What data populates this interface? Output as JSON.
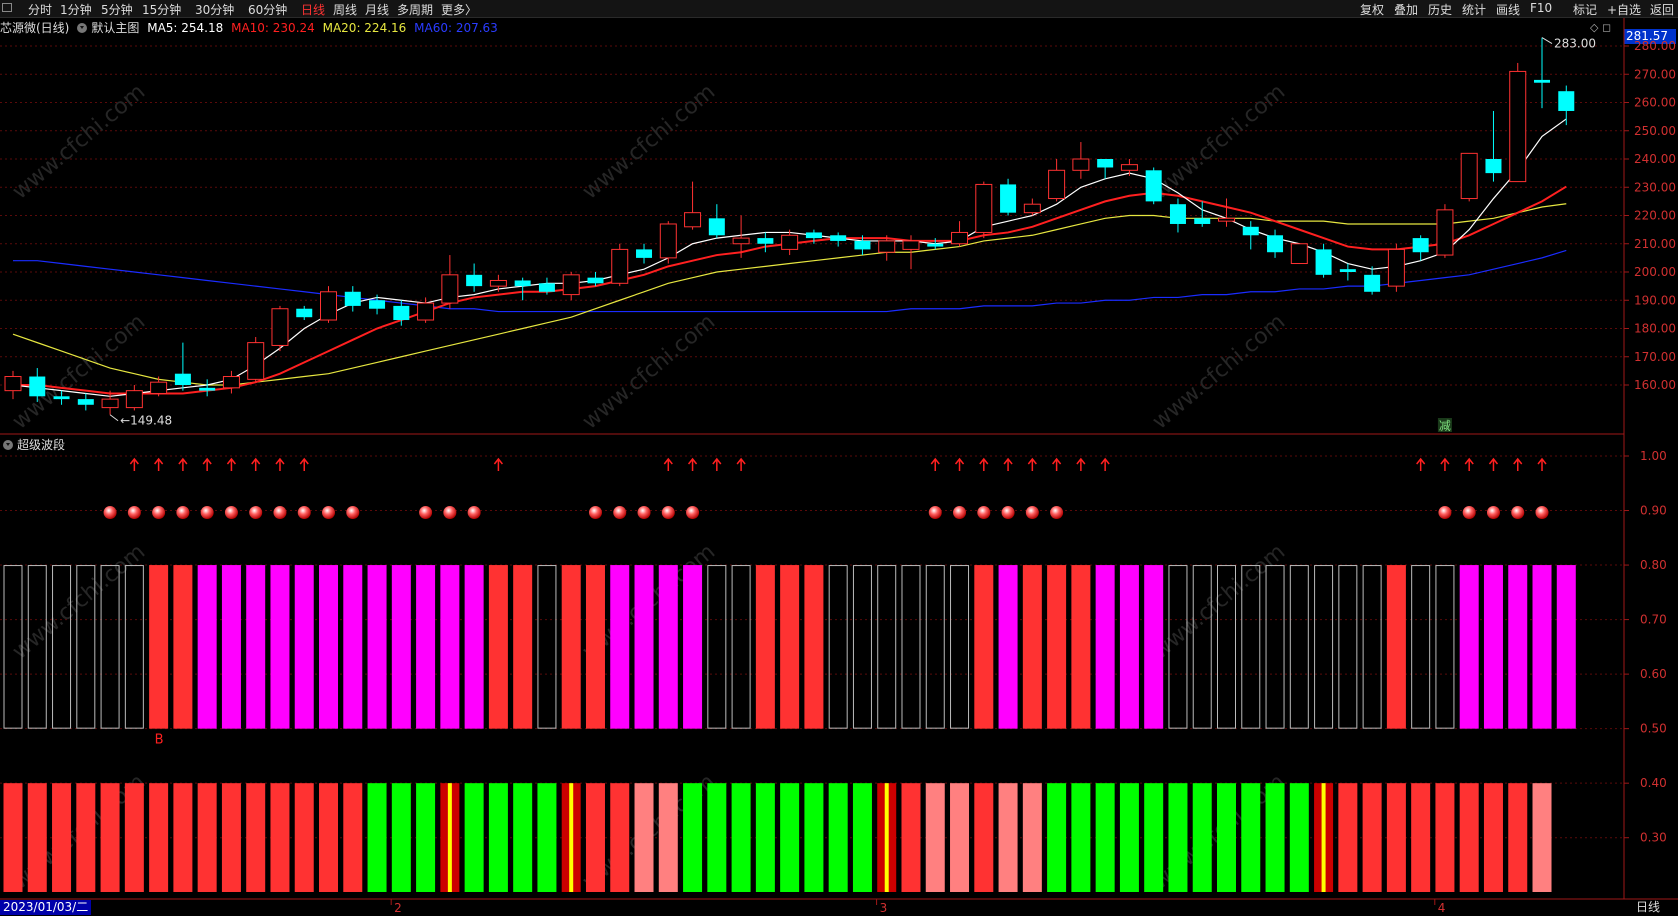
{
  "toolbar": {
    "left": [
      {
        "label": "分时",
        "active": false
      },
      {
        "label": "1分钟",
        "active": false
      },
      {
        "label": "5分钟",
        "active": false
      },
      {
        "label": "15分钟",
        "active": false
      },
      {
        "label": "30分钟",
        "active": false
      },
      {
        "label": "60分钟",
        "active": false
      },
      {
        "label": "日线",
        "active": true
      },
      {
        "label": "周线",
        "active": false
      },
      {
        "label": "月线",
        "active": false
      },
      {
        "label": "多周期",
        "active": false
      },
      {
        "label": "更多〉",
        "active": false
      }
    ],
    "right": [
      "复权",
      "叠加",
      "历史",
      "统计",
      "画线",
      "F10",
      "标记",
      "+自选",
      "返回"
    ]
  },
  "info": {
    "stock": "芯源微(日线)",
    "main_chart": "默认主图",
    "ma5": "MA5: 254.18",
    "ma10": "MA10: 230.24",
    "ma20": "MA20: 224.16",
    "ma60": "MA60: 207.63"
  },
  "colors": {
    "ma5": "#ffffff",
    "ma10": "#ff2020",
    "ma20": "#e6e640",
    "ma60": "#1a2cff",
    "up": "#ff3232",
    "down": "#00ffff",
    "magenta": "#ff00ff",
    "green": "#00ff00",
    "pink": "#ff8080"
  },
  "indicator": {
    "name": "超级波段",
    "buy_label": "B",
    "bottom_label": "减"
  },
  "price_tag": "281.57",
  "high_label": "283.00",
  "low_label": "149.48",
  "date_label": "2023/01/03/二",
  "period_label": "日线",
  "month_labels": [
    "2",
    "3",
    "4"
  ],
  "chart_data": {
    "type": "candlestick",
    "price_axis": {
      "ticks": [
        160,
        170,
        180,
        190,
        200,
        210,
        220,
        230,
        240,
        250,
        260,
        270,
        280
      ]
    },
    "indicator_axis": {
      "ticks": [
        "1.00",
        "0.90",
        "0.80",
        "0.70",
        "0.60",
        "0.50",
        "0.40",
        "0.30"
      ]
    },
    "candles": [
      [
        158.0,
        163.0,
        165.0,
        155.0
      ],
      [
        163.0,
        156.0,
        166.0,
        154.0
      ],
      [
        156.0,
        155.0,
        158.0,
        153.0
      ],
      [
        155.0,
        153.0,
        157.0,
        151.0
      ],
      [
        152.0,
        155.0,
        158.0,
        149.48
      ],
      [
        152.0,
        158.0,
        160.0,
        151.0
      ],
      [
        157.0,
        161.0,
        163.0,
        156.0
      ],
      [
        164.0,
        160.0,
        175.0,
        158.0
      ],
      [
        159.0,
        158.0,
        162.0,
        156.0
      ],
      [
        159.0,
        163.0,
        165.0,
        157.0
      ],
      [
        162.0,
        175.0,
        177.0,
        161.0
      ],
      [
        174.0,
        187.0,
        188.0,
        172.0
      ],
      [
        187.0,
        184.0,
        188.0,
        183.0
      ],
      [
        183.0,
        193.0,
        195.0,
        182.0
      ],
      [
        193.0,
        188.0,
        195.0,
        186.0
      ],
      [
        190.0,
        187.0,
        192.0,
        185.0
      ],
      [
        188.0,
        183.0,
        190.0,
        181.0
      ],
      [
        183.0,
        189.0,
        191.0,
        182.0
      ],
      [
        189.0,
        199.0,
        206.0,
        187.0
      ],
      [
        199.0,
        195.0,
        203.0,
        193.0
      ],
      [
        195.0,
        197.0,
        199.0,
        193.0
      ],
      [
        197.0,
        195.0,
        198.0,
        190.0
      ],
      [
        196.0,
        193.0,
        198.0,
        192.0
      ],
      [
        192.0,
        199.0,
        200.0,
        190.0
      ],
      [
        198.0,
        196.0,
        200.0,
        195.0
      ],
      [
        196.0,
        208.0,
        210.0,
        195.0
      ],
      [
        208.0,
        205.0,
        210.0,
        203.0
      ],
      [
        205.0,
        217.0,
        218.0,
        203.0
      ],
      [
        216.0,
        221.0,
        232.0,
        215.0
      ],
      [
        219.0,
        213.0,
        224.0,
        212.0
      ],
      [
        210.0,
        212.0,
        220.0,
        205.0
      ],
      [
        212.0,
        210.0,
        214.0,
        207.0
      ],
      [
        208.0,
        213.0,
        215.0,
        206.0
      ],
      [
        214.0,
        212.0,
        215.0,
        210.0
      ],
      [
        213.0,
        211.0,
        214.0,
        209.0
      ],
      [
        211.0,
        208.0,
        213.0,
        206.0
      ],
      [
        207.0,
        211.0,
        213.0,
        204.0
      ],
      [
        208.0,
        211.0,
        213.0,
        201.0
      ],
      [
        210.0,
        209.0,
        212.0,
        208.0
      ],
      [
        210.0,
        214.0,
        218.0,
        209.0
      ],
      [
        214.0,
        231.0,
        232.0,
        212.0
      ],
      [
        231.0,
        221.0,
        233.0,
        220.0
      ],
      [
        221.0,
        224.0,
        226.0,
        220.0
      ],
      [
        226.0,
        236.0,
        240.0,
        225.0
      ],
      [
        236.0,
        240.0,
        246.0,
        233.0
      ],
      [
        240.0,
        237.0,
        240.0,
        233.0
      ],
      [
        236.0,
        238.0,
        240.0,
        234.0
      ],
      [
        236.0,
        225.0,
        237.0,
        224.0
      ],
      [
        224.0,
        217.0,
        226.0,
        214.0
      ],
      [
        219.0,
        217.0,
        225.0,
        216.0
      ],
      [
        218.0,
        219.0,
        226.0,
        216.0
      ],
      [
        216.0,
        213.0,
        218.0,
        208.0
      ],
      [
        213.0,
        207.0,
        215.0,
        205.0
      ],
      [
        203.0,
        210.0,
        210.0,
        203.0
      ],
      [
        208.0,
        199.0,
        210.0,
        198.0
      ],
      [
        201.0,
        200.0,
        203.0,
        197.0
      ],
      [
        199.0,
        193.0,
        202.0,
        192.0
      ],
      [
        195.0,
        208.0,
        210.0,
        193.0
      ],
      [
        212.0,
        207.0,
        213.0,
        204.0
      ],
      [
        206.0,
        222.0,
        224.0,
        205.0
      ],
      [
        226.0,
        242.0,
        242.0,
        225.0
      ],
      [
        240.0,
        235.0,
        257.0,
        232.0
      ],
      [
        232.0,
        271.0,
        274.0,
        232.0
      ],
      [
        268.0,
        267.0,
        283.0,
        258.0
      ],
      [
        264.0,
        257.0,
        266.0,
        252.0
      ]
    ],
    "ma5": [
      160.0,
      159.0,
      158.0,
      157.0,
      156.0,
      157.0,
      158.0,
      159.0,
      160.0,
      162.0,
      167.0,
      173.0,
      180.0,
      185.0,
      189.0,
      191.0,
      190.0,
      189.0,
      191.0,
      192.0,
      194.0,
      195.0,
      196.0,
      196.0,
      197.0,
      199.0,
      201.0,
      205.0,
      210.0,
      212.0,
      213.0,
      214.0,
      214.0,
      213.0,
      212.0,
      211.0,
      211.0,
      211.0,
      210.0,
      211.0,
      216.0,
      218.0,
      220.0,
      224.0,
      230.0,
      233.0,
      235.0,
      233.0,
      228.0,
      222.0,
      219.0,
      215.0,
      212.0,
      210.0,
      207.0,
      203.0,
      201.0,
      202.0,
      204.0,
      207.0,
      215.0,
      226.0,
      236.0,
      248.0,
      254.18
    ],
    "ma10": [
      160.0,
      160.0,
      159.0,
      158.0,
      157.0,
      157.0,
      157.0,
      157.0,
      158.0,
      159.0,
      161.0,
      164.0,
      168.0,
      172.0,
      176.0,
      180.0,
      183.0,
      186.0,
      189.0,
      191.0,
      192.0,
      193.0,
      193.0,
      194.0,
      195.0,
      197.0,
      199.0,
      202.0,
      204.0,
      206.0,
      207.0,
      209.0,
      210.0,
      211.0,
      212.0,
      212.0,
      212.0,
      211.0,
      211.0,
      211.0,
      213.0,
      214.0,
      216.0,
      219.0,
      222.0,
      225.0,
      227.0,
      228.0,
      227.0,
      225.0,
      223.0,
      221.0,
      218.0,
      215.0,
      212.0,
      209.0,
      208.0,
      208.0,
      209.0,
      210.0,
      213.0,
      217.0,
      221.0,
      225.0,
      230.24
    ],
    "ma20": [
      178.0,
      175.0,
      172.0,
      169.0,
      166.0,
      164.0,
      162.0,
      161.0,
      160.0,
      160.0,
      161.0,
      162.0,
      163.0,
      164.0,
      166.0,
      168.0,
      170.0,
      172.0,
      174.0,
      176.0,
      178.0,
      180.0,
      182.0,
      184.0,
      187.0,
      190.0,
      193.0,
      196.0,
      198.0,
      200.0,
      201.0,
      202.0,
      203.0,
      204.0,
      205.0,
      206.0,
      207.0,
      207.0,
      208.0,
      209.0,
      211.0,
      212.0,
      213.0,
      215.0,
      217.0,
      219.0,
      220.0,
      220.0,
      219.0,
      219.0,
      219.0,
      219.0,
      218.0,
      218.0,
      218.0,
      217.0,
      217.0,
      217.0,
      217.0,
      217.0,
      218.0,
      219.0,
      221.0,
      223.0,
      224.16
    ],
    "ma60": [
      204.0,
      204.0,
      203.0,
      202.0,
      201.0,
      200.0,
      199.0,
      198.0,
      197.0,
      196.0,
      195.0,
      194.0,
      193.0,
      192.0,
      191.0,
      190.0,
      189.0,
      188.0,
      187.0,
      187.0,
      186.0,
      186.0,
      186.0,
      186.0,
      186.0,
      186.0,
      186.0,
      186.0,
      186.0,
      186.0,
      186.0,
      186.0,
      186.0,
      186.0,
      186.0,
      186.0,
      186.0,
      187.0,
      187.0,
      187.0,
      188.0,
      188.0,
      188.0,
      189.0,
      189.0,
      190.0,
      190.0,
      191.0,
      191.0,
      192.0,
      192.0,
      193.0,
      193.0,
      194.0,
      194.0,
      195.0,
      195.0,
      196.0,
      197.0,
      198.0,
      199.0,
      201.0,
      203.0,
      205.0,
      207.63
    ],
    "arrows": [
      5,
      6,
      7,
      8,
      9,
      10,
      11,
      12,
      20,
      27,
      28,
      29,
      30,
      38,
      39,
      40,
      41,
      42,
      43,
      44,
      45,
      58,
      59,
      60,
      61,
      62,
      63
    ],
    "dots": [
      4,
      5,
      6,
      7,
      8,
      9,
      10,
      11,
      12,
      13,
      14,
      17,
      18,
      19,
      24,
      25,
      26,
      27,
      28,
      38,
      39,
      40,
      41,
      42,
      43,
      59,
      60,
      61,
      62,
      63
    ],
    "band_upper": "EEEEEERRMMMMMMMMMMMMRRERRMMMMEERRREEEEEERMRRRMMMEEEEEEEEEREEMMMMM",
    "band_lower": "RRRRRRRRRRRRRRRGGGXGGGGXRRPPGGGGGGGGXRPPRPPGGGGGGGGGGGXRRRRRRRRP",
    "buy_index": 6,
    "reduce_index": 59,
    "month_start_index": [
      16,
      36,
      59
    ]
  }
}
